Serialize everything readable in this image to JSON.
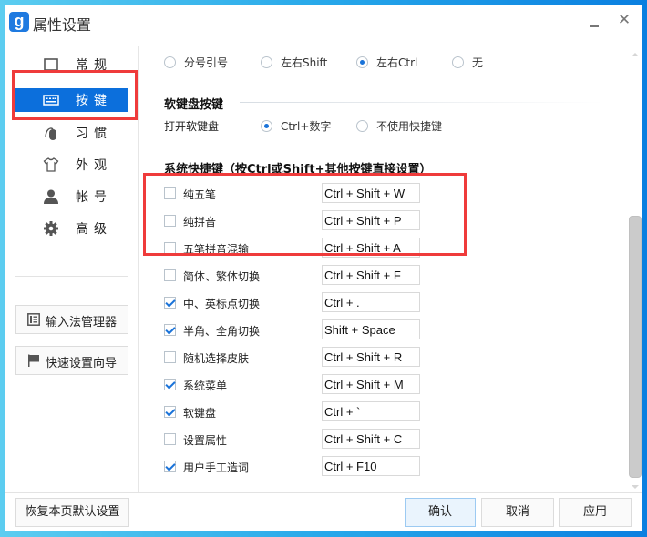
{
  "window": {
    "title": "属性设置",
    "logo_glyph": "g",
    "minimize_glyph": "",
    "close_glyph": "✕"
  },
  "sidebar": {
    "items": [
      {
        "label": "常规",
        "icon": "window-icon",
        "active": false
      },
      {
        "label": "按键",
        "icon": "keyboard-icon",
        "active": true
      },
      {
        "label": "习惯",
        "icon": "mouse-icon",
        "active": false
      },
      {
        "label": "外观",
        "icon": "tshirt-icon",
        "active": false
      },
      {
        "label": "帐号",
        "icon": "user-icon",
        "active": false
      },
      {
        "label": "高级",
        "icon": "gear-icon",
        "active": false
      }
    ],
    "buttons": [
      {
        "label": "输入法管理器",
        "icon": "list-icon"
      },
      {
        "label": "快速设置向导",
        "icon": "flag-icon"
      }
    ]
  },
  "content": {
    "switch_options": [
      {
        "label": "分号引号",
        "selected": false
      },
      {
        "label": "左右Shift",
        "selected": false
      },
      {
        "label": "左右Ctrl",
        "selected": true
      },
      {
        "label": "无",
        "selected": false
      }
    ],
    "soft_keyboard": {
      "title": "软键盘按键",
      "label": "打开软键盘",
      "options": [
        {
          "label": "Ctrl+数字",
          "selected": true
        },
        {
          "label": "不使用快捷键",
          "selected": false
        }
      ]
    },
    "system_hotkeys": {
      "title": "系统快捷键（按Ctrl或Shift+其他按键直接设置）",
      "rows": [
        {
          "label": "纯五笔",
          "checked": false,
          "value": "Ctrl + Shift + W"
        },
        {
          "label": "纯拼音",
          "checked": false,
          "value": "Ctrl + Shift + P"
        },
        {
          "label": "五笔拼音混输",
          "checked": false,
          "value": "Ctrl + Shift + A"
        },
        {
          "label": "简体、繁体切换",
          "checked": false,
          "value": "Ctrl + Shift + F"
        },
        {
          "label": "中、英标点切换",
          "checked": true,
          "value": "Ctrl + ."
        },
        {
          "label": "半角、全角切换",
          "checked": true,
          "value": "Shift + Space"
        },
        {
          "label": "随机选择皮肤",
          "checked": false,
          "value": "Ctrl + Shift + R"
        },
        {
          "label": "系统菜单",
          "checked": true,
          "value": "Ctrl + Shift + M"
        },
        {
          "label": "软键盘",
          "checked": true,
          "value": "Ctrl + `"
        },
        {
          "label": "设置属性",
          "checked": false,
          "value": "Ctrl + Shift + C"
        },
        {
          "label": "用户手工造词",
          "checked": true,
          "value": "Ctrl + F10"
        }
      ]
    }
  },
  "scroll": {
    "position_fraction": 1.0
  },
  "footer": {
    "restore_label": "恢复本页默认设置",
    "ok_label": "确认",
    "cancel_label": "取消",
    "apply_label": "应用"
  },
  "colors": {
    "accent": "#0c6fdc",
    "highlight_box": "#ef3b3b",
    "check": "#1a73d9"
  }
}
